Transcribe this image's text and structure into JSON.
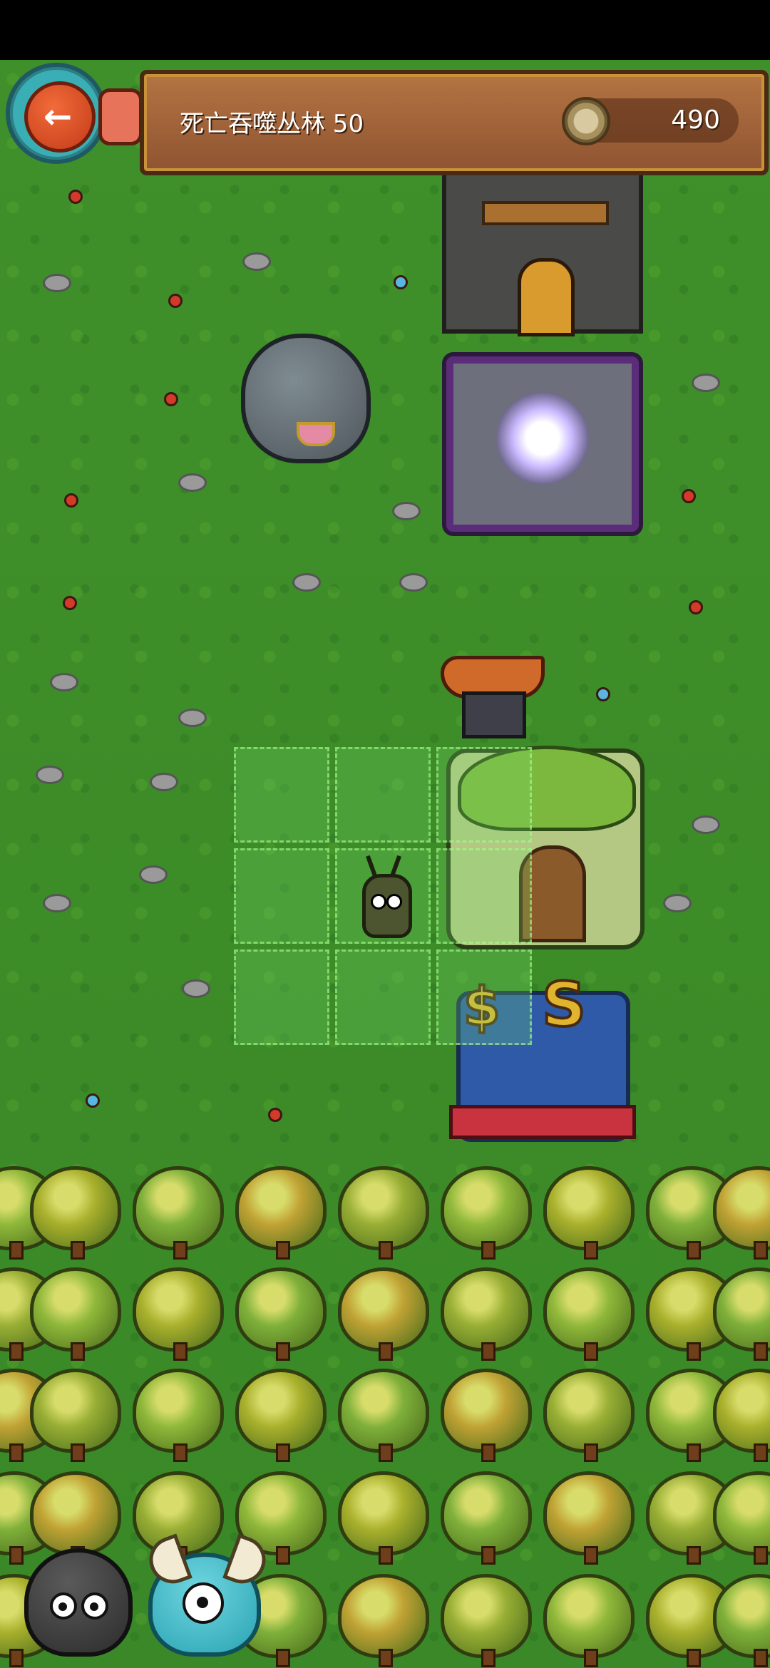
{
  "header": {
    "level_title": "死亡吞噬丛林 50",
    "coin_count": "490"
  },
  "icons": {
    "back": "arrow-left-icon",
    "coin": "coin-icon"
  },
  "colors": {
    "grass": "#3f902a",
    "banner_wood": "#b47442",
    "back_button": "#f26b3a"
  },
  "map": {
    "buildings": [
      "stone-tower",
      "portal-shrine",
      "anvil-forge",
      "plant-house",
      "shop"
    ],
    "selection_grid": {
      "rows": 3,
      "cols": 3
    }
  },
  "characters": [
    "black-blob",
    "blue-horned-monster"
  ]
}
